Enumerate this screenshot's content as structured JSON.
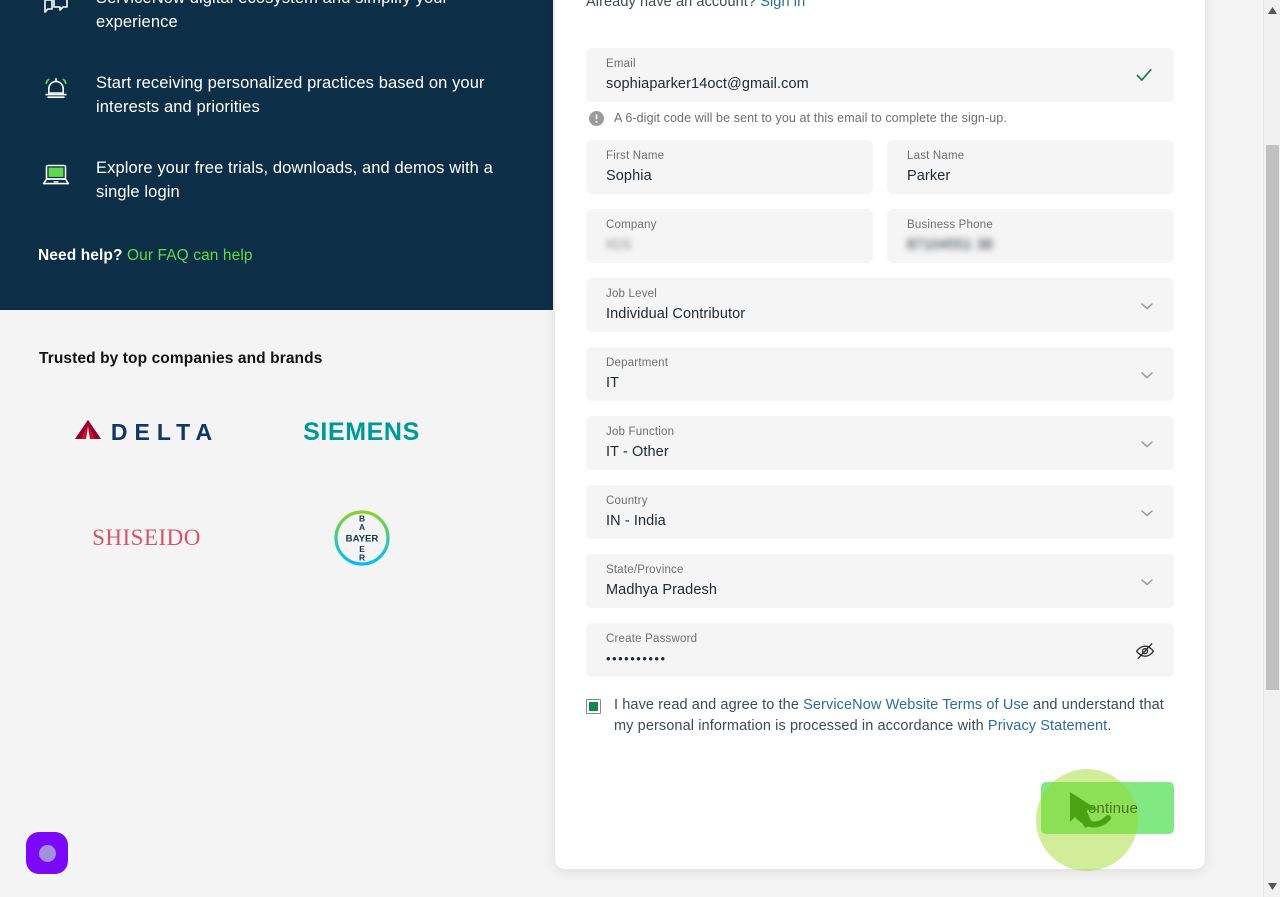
{
  "left_panel": {
    "benefits": [
      {
        "icon": "speech-bubble-icon",
        "text": "ServiceNow digital ecosystem and simplify your experience"
      },
      {
        "icon": "bell-icon",
        "text": "Start receiving personalized practices based on your interests and priorities"
      },
      {
        "icon": "laptop-icon",
        "text": "Explore your free trials, downloads, and demos with a single login"
      }
    ],
    "need_help_prefix": "Need help?",
    "need_help_link": "Our FAQ can help"
  },
  "trusted": {
    "title": "Trusted by top companies and brands",
    "logos": [
      {
        "name": "delta",
        "label": "DELTA"
      },
      {
        "name": "siemens",
        "label": "SIEMENS"
      },
      {
        "name": "shiseido",
        "label": "SHISEIDO"
      },
      {
        "name": "bayer",
        "label": "BAYER"
      }
    ]
  },
  "form": {
    "signin_prompt": "Already have an account?",
    "signin_link": "Sign in",
    "email": {
      "label": "Email",
      "value": "sophiaparker14oct@gmail.com",
      "valid": true,
      "hint": "A 6-digit code will be sent to you at this email to complete the sign-up."
    },
    "first_name": {
      "label": "First Name",
      "value": "Sophia"
    },
    "last_name": {
      "label": "Last Name",
      "value": "Parker"
    },
    "company": {
      "label": "Company",
      "value": "IGS"
    },
    "business_phone": {
      "label": "Business Phone",
      "value": "87104551 38"
    },
    "job_level": {
      "label": "Job Level",
      "value": "Individual Contributor"
    },
    "department": {
      "label": "Department",
      "value": "IT"
    },
    "job_function": {
      "label": "Job Function",
      "value": "IT - Other"
    },
    "country": {
      "label": "Country",
      "value": "IN - India"
    },
    "state_province": {
      "label": "State/Province",
      "value": "Madhya Pradesh"
    },
    "password": {
      "label": "Create Password",
      "value": "••••••••••"
    },
    "terms": {
      "checked": true,
      "part1": "I have read and agree to the ",
      "link1": "ServiceNow Website Terms of Use",
      "part2": " and understand that my personal information is processed in accordance with ",
      "link2": "Privacy Statement",
      "part3": "."
    },
    "continue_label": "Continue"
  },
  "colors": {
    "panel_navy": "#0c2e47",
    "accent_green": "#62d84e",
    "button_green": "#81e882",
    "link_blue": "#2a6d9e",
    "checkbox_green": "#13874b",
    "assistant_purple": "#7b08f7"
  }
}
